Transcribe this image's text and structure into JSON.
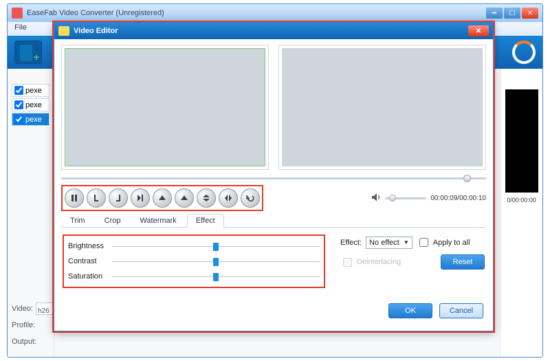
{
  "window": {
    "title": "EaseFab Video Converter (Unregistered)"
  },
  "menu": {
    "file": "File"
  },
  "filelist": {
    "items": [
      {
        "name": "pexe",
        "checked": true,
        "selected": false
      },
      {
        "name": "pexe",
        "checked": true,
        "selected": false
      },
      {
        "name": "pexe",
        "checked": true,
        "selected": true
      }
    ]
  },
  "bottom": {
    "video_label": "Video:",
    "video_value": "h26",
    "profile_label": "Profile:",
    "output_label": "Output:"
  },
  "rightpreview": {
    "time": "0/00:00:00"
  },
  "dialog": {
    "title": "Video Editor",
    "time": "00:00:09/00:00:10",
    "tabs": {
      "trim": "Trim",
      "crop": "Crop",
      "watermark": "Watermark",
      "effect": "Effect",
      "active": "Effect"
    },
    "sliders": {
      "brightness": "Brightness",
      "contrast": "Contrast",
      "saturation": "Saturation"
    },
    "effect_label": "Effect:",
    "effect_value": "No effect",
    "apply_all": "Apply to all",
    "deinterlacing": "Deinterlacing",
    "reset": "Reset",
    "ok": "OK",
    "cancel": "Cancel"
  }
}
